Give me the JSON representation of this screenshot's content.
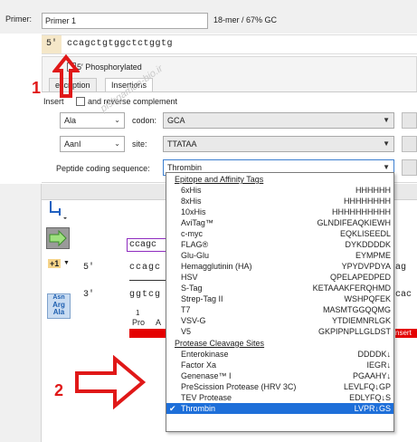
{
  "primer": {
    "label": "Primer:",
    "name": "Primer 1",
    "stats": "18-mer / 67% GC",
    "five_prime": "5′",
    "sequence": "ccagctgtggctctggtg"
  },
  "phosphorylated_label": "5′ Phosphorylated",
  "tabs": [
    {
      "label": "escription",
      "active": false
    },
    {
      "label": "Insertions",
      "active": true
    }
  ],
  "insertions": {
    "insert_label": "Insert",
    "reverse_complement_label": "and reverse complement",
    "codon_label": "codon:",
    "amino_acid": "Ala",
    "codon": "GCA",
    "enzyme": "AanI",
    "site_label": "site:",
    "site": "TTATAA",
    "peptide_label": "Peptide coding sequence:",
    "peptide_selected": "Thrombin"
  },
  "dropdown": {
    "sections": [
      {
        "title": "Epitope and Affinity Tags",
        "items": [
          {
            "name": "6xHis",
            "seq": "HHHHHH"
          },
          {
            "name": "8xHis",
            "seq": "HHHHHHHH"
          },
          {
            "name": "10xHis",
            "seq": "HHHHHHHHHH"
          },
          {
            "name": "AviTag™",
            "seq": "GLNDIFEAQKIEWH"
          },
          {
            "name": "c-myc",
            "seq": "EQKLISEEDL"
          },
          {
            "name": "FLAG®",
            "seq": "DYKDDDDK"
          },
          {
            "name": "Glu-Glu",
            "seq": "EYMPME"
          },
          {
            "name": "Hemagglutinin (HA)",
            "seq": "YPYDVPDYA"
          },
          {
            "name": "HSV",
            "seq": "QPELAPEDPED"
          },
          {
            "name": "S-Tag",
            "seq": "KETAAAKFERQHMD"
          },
          {
            "name": "Strep-Tag II",
            "seq": "WSHPQFEK"
          },
          {
            "name": "T7",
            "seq": "MASMTGGQQMG"
          },
          {
            "name": "VSV-G",
            "seq": "YTDIEMNRLGK"
          },
          {
            "name": "V5",
            "seq": "GKPIPNPLLGLDST"
          }
        ]
      },
      {
        "title": "Protease Cleavage Sites",
        "items": [
          {
            "name": "Enterokinase",
            "seq": "DDDDK↓"
          },
          {
            "name": "Factor Xa",
            "seq": "IEGR↓"
          },
          {
            "name": "Genenase™ I",
            "seq": "PGAAHY↓"
          },
          {
            "name": "PreScission Protease (HRV 3C)",
            "seq": "LEVLFQ↓GP"
          },
          {
            "name": "TEV Protease",
            "seq": "EDLYFQ↓S"
          },
          {
            "name": "Thrombin",
            "seq": "LVPR↓GS",
            "selected": true
          }
        ]
      }
    ]
  },
  "sequence_view": {
    "primer_top": "ccagc",
    "strand_label_5": "5′",
    "strand_label_3": "3′",
    "top_strand": "ccagc",
    "bottom_strand": "ggtcg",
    "right_top": "ag",
    "right_bottom": "cac",
    "aa_number": "1",
    "aa_labels": [
      "Pro",
      "A"
    ],
    "insert_tag": "nsert"
  },
  "toolbar_left": {
    "frame_label": "+1",
    "aa_button": [
      "Asn",
      "Arg",
      "Ala"
    ]
  },
  "annotations": {
    "number_1": "1",
    "number_2": "2",
    "watermark": "pishgaman-bio.ir"
  },
  "colors": {
    "accent_blue": "#1e6fd9",
    "annotation_red": "#e01818",
    "insert_red": "#e40000",
    "primer_purple": "#8e2bbf"
  }
}
